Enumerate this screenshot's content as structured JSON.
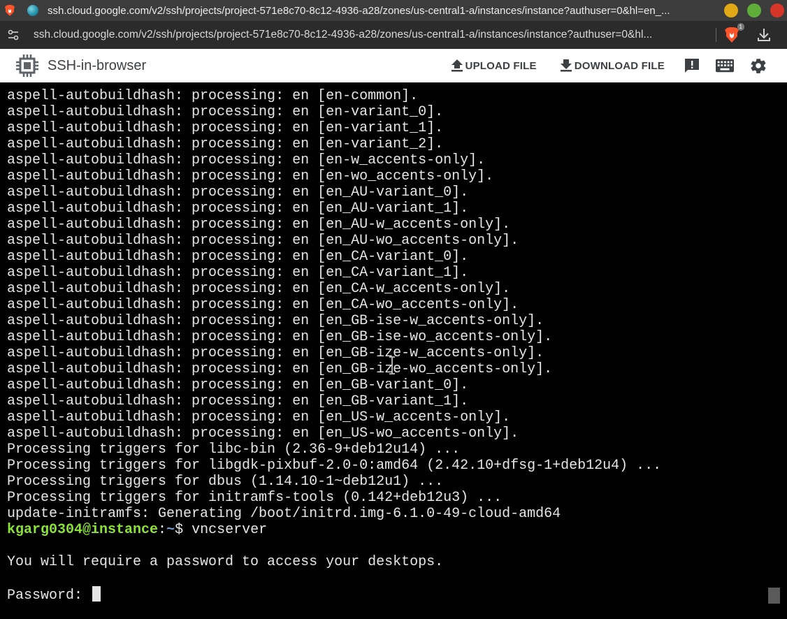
{
  "browser": {
    "tab_title": "ssh.cloud.google.com/v2/ssh/projects/project-571e8c70-8c12-4936-a28/zones/us-central1-a/instances/instance?authuser=0&hl=en_...",
    "url": "ssh.cloud.google.com/v2/ssh/projects/project-571e8c70-8c12-4936-a28/zones/us-central1-a/instances/instance?authuser=0&hl...",
    "shield_badge": "1"
  },
  "app": {
    "title": "SSH-in-browser",
    "upload_label": "UPLOAD FILE",
    "download_label": "DOWNLOAD FILE"
  },
  "terminal": {
    "lines": [
      "aspell-autobuildhash: processing: en [en-common].",
      "aspell-autobuildhash: processing: en [en-variant_0].",
      "aspell-autobuildhash: processing: en [en-variant_1].",
      "aspell-autobuildhash: processing: en [en-variant_2].",
      "aspell-autobuildhash: processing: en [en-w_accents-only].",
      "aspell-autobuildhash: processing: en [en-wo_accents-only].",
      "aspell-autobuildhash: processing: en [en_AU-variant_0].",
      "aspell-autobuildhash: processing: en [en_AU-variant_1].",
      "aspell-autobuildhash: processing: en [en_AU-w_accents-only].",
      "aspell-autobuildhash: processing: en [en_AU-wo_accents-only].",
      "aspell-autobuildhash: processing: en [en_CA-variant_0].",
      "aspell-autobuildhash: processing: en [en_CA-variant_1].",
      "aspell-autobuildhash: processing: en [en_CA-w_accents-only].",
      "aspell-autobuildhash: processing: en [en_CA-wo_accents-only].",
      "aspell-autobuildhash: processing: en [en_GB-ise-w_accents-only].",
      "aspell-autobuildhash: processing: en [en_GB-ise-wo_accents-only].",
      "aspell-autobuildhash: processing: en [en_GB-ize-w_accents-only].",
      "aspell-autobuildhash: processing: en [en_GB-ize-wo_accents-only].",
      "aspell-autobuildhash: processing: en [en_GB-variant_0].",
      "aspell-autobuildhash: processing: en [en_GB-variant_1].",
      "aspell-autobuildhash: processing: en [en_US-w_accents-only].",
      "aspell-autobuildhash: processing: en [en_US-wo_accents-only].",
      "Processing triggers for libc-bin (2.36-9+deb12u14) ...",
      "Processing triggers for libgdk-pixbuf-2.0-0:amd64 (2.42.10+dfsg-1+deb12u4) ...",
      "Processing triggers for dbus (1.14.10-1~deb12u1) ...",
      "Processing triggers for initramfs-tools (0.142+deb12u3) ...",
      "update-initramfs: Generating /boot/initrd.img-6.1.0-49-cloud-amd64"
    ],
    "prompt_user": "kgarg0304@instance",
    "prompt_sep": ":",
    "prompt_path": "~",
    "prompt_symbol": "$ ",
    "command": "vncserver",
    "message": "You will require a password to access your desktops.",
    "password_prompt": "Password: "
  },
  "colors": {
    "prompt_user": "#8ae234",
    "prompt_path": "#729fcf",
    "terminal_bg": "#000000",
    "terminal_fg": "#e6e6e6"
  }
}
